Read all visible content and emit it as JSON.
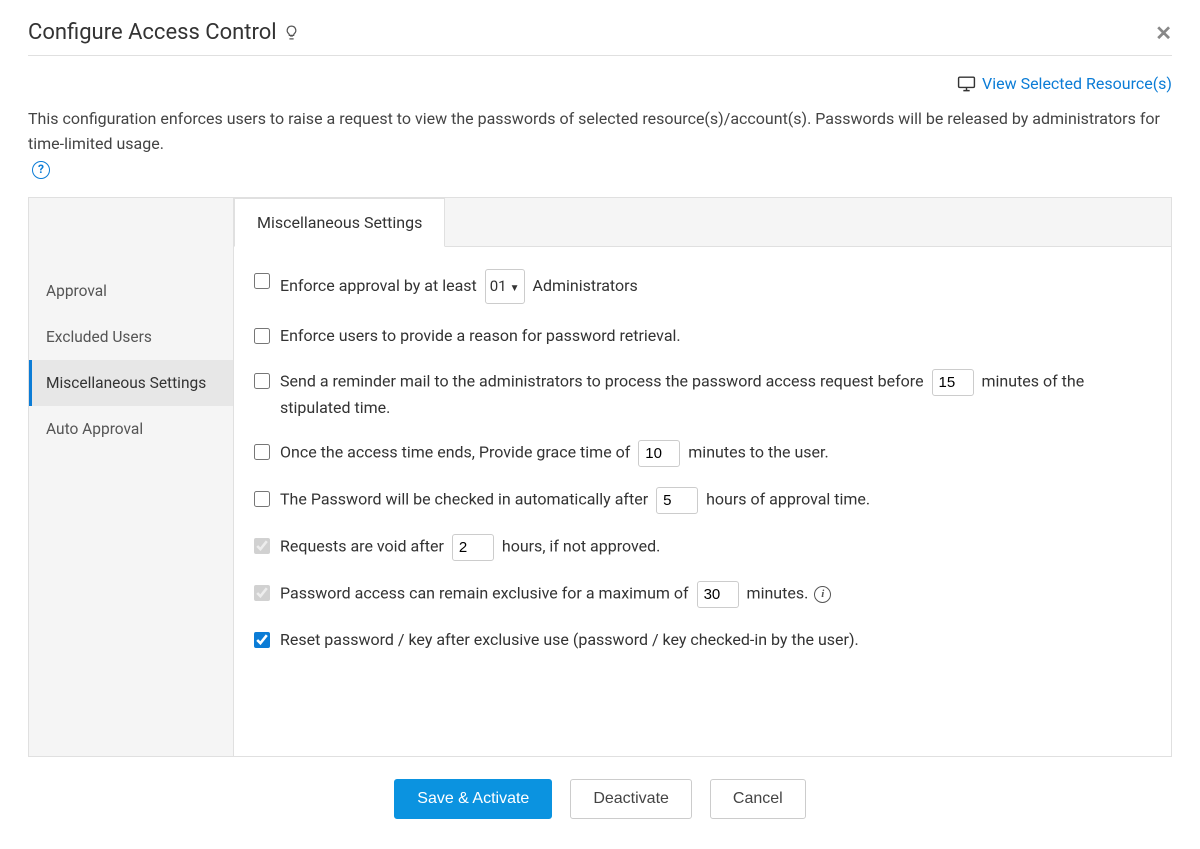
{
  "header": {
    "title": "Configure Access Control"
  },
  "topbar": {
    "view_resources_label": "View Selected Resource(s)"
  },
  "description": {
    "text": "This configuration enforces users to raise a request to view the passwords of selected resource(s)/account(s). Passwords will be released by administrators for time-limited usage."
  },
  "sidebar": {
    "items": [
      {
        "label": "Approval"
      },
      {
        "label": "Excluded Users"
      },
      {
        "label": "Miscellaneous Settings"
      },
      {
        "label": "Auto Approval"
      }
    ]
  },
  "tab": {
    "label": "Miscellaneous Settings"
  },
  "settings": {
    "enforce_approval_prefix": "Enforce approval by at least",
    "enforce_approval_value": "01",
    "enforce_approval_suffix": "Administrators",
    "enforce_reason": "Enforce users to provide a reason for password retrieval.",
    "reminder_prefix": "Send a reminder mail to the administrators to process the password access request before",
    "reminder_value": "15",
    "reminder_suffix": "minutes of the stipulated time.",
    "grace_prefix": "Once the access time ends, Provide grace time of",
    "grace_value": "10",
    "grace_suffix": "minutes to the user.",
    "checkin_prefix": "The Password will be checked in automatically after",
    "checkin_value": "5",
    "checkin_suffix": "hours of approval time.",
    "void_prefix": "Requests are void after",
    "void_value": "2",
    "void_suffix": "hours, if not approved.",
    "exclusive_prefix": "Password access can remain exclusive for a maximum of",
    "exclusive_value": "30",
    "exclusive_suffix": "minutes.",
    "reset_label": "Reset password / key after exclusive use (password / key checked-in by the user)."
  },
  "buttons": {
    "save": "Save & Activate",
    "deactivate": "Deactivate",
    "cancel": "Cancel"
  }
}
